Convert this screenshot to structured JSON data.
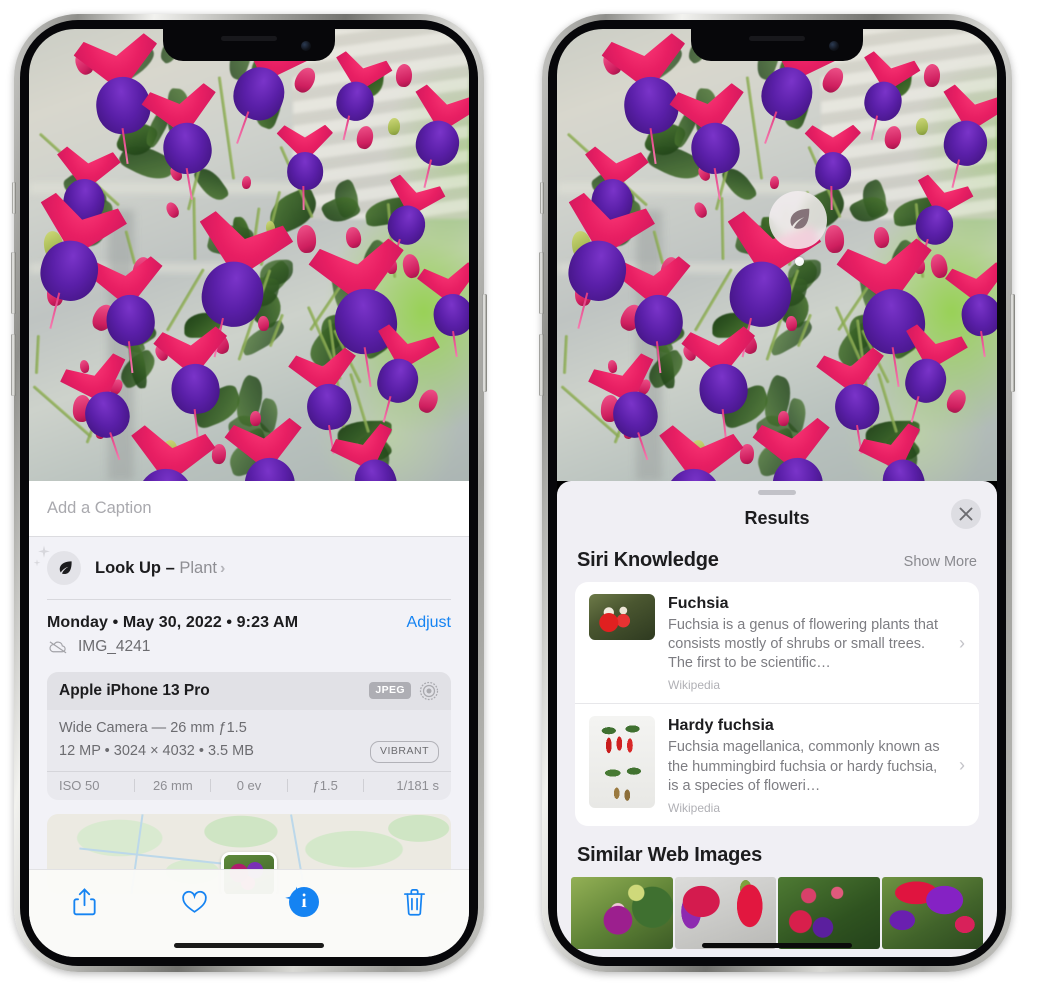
{
  "left_phone": {
    "name": "photos-detail-view",
    "photo": {
      "alt": "Fuchsia flowers hanging basket on porch"
    },
    "caption": {
      "placeholder": "Add a Caption",
      "value": ""
    },
    "lookup": {
      "icon": "leaf-icon",
      "label": "Look Up",
      "dash": " – ",
      "subject": "Plant",
      "chevron": "›"
    },
    "datetime": "Monday • May 30, 2022 • 9:23 AM",
    "adjust_label": "Adjust",
    "filename": "IMG_4241",
    "filename_icon": "icloud-slash-icon",
    "exif": {
      "device": "Apple iPhone 13 Pro",
      "format_badge": "JPEG",
      "lens_icon": "aperture-icon",
      "lens_line": "Wide Camera — 26 mm ƒ1.5",
      "size_line": "12 MP • 3024 × 4032 • 3.5 MB",
      "style_badge": "VIBRANT",
      "stats": [
        "ISO 50",
        "26 mm",
        "0 ev",
        "ƒ1.5",
        "1/181 s"
      ]
    },
    "toolbar": [
      {
        "name": "share-button",
        "icon": "share-icon"
      },
      {
        "name": "favorite-button",
        "icon": "heart-icon"
      },
      {
        "name": "info-button",
        "icon": "info-sparkle-icon"
      },
      {
        "name": "delete-button",
        "icon": "trash-icon"
      }
    ]
  },
  "right_phone": {
    "name": "visual-lookup-results",
    "badge": {
      "icon": "leaf-icon"
    },
    "sheet": {
      "title": "Results",
      "close_icon": "close-icon"
    },
    "siri_knowledge": {
      "title": "Siri Knowledge",
      "action": "Show More",
      "items": [
        {
          "title": "Fuchsia",
          "description": "Fuchsia is a genus of flowering plants that consists mostly of shrubs or small trees. The first to be scientific…",
          "source": "Wikipedia",
          "chevron": "›"
        },
        {
          "title": "Hardy fuchsia",
          "description": "Fuchsia magellanica, commonly known as the hummingbird fuchsia or hardy fuchsia, is a species of floweri…",
          "source": "Wikipedia",
          "chevron": "›"
        }
      ]
    },
    "similar_web_images": {
      "title": "Similar Web Images",
      "count": 4
    }
  },
  "colors": {
    "accent_blue": "#1583f2",
    "sheet_bg": "#f0eff4",
    "info_bg": "#f2f2f7",
    "card_bg": "#ffffff",
    "exif_card": "#e9e9ee",
    "text_primary": "#1c1c1e",
    "text_secondary": "#8e8e93"
  }
}
